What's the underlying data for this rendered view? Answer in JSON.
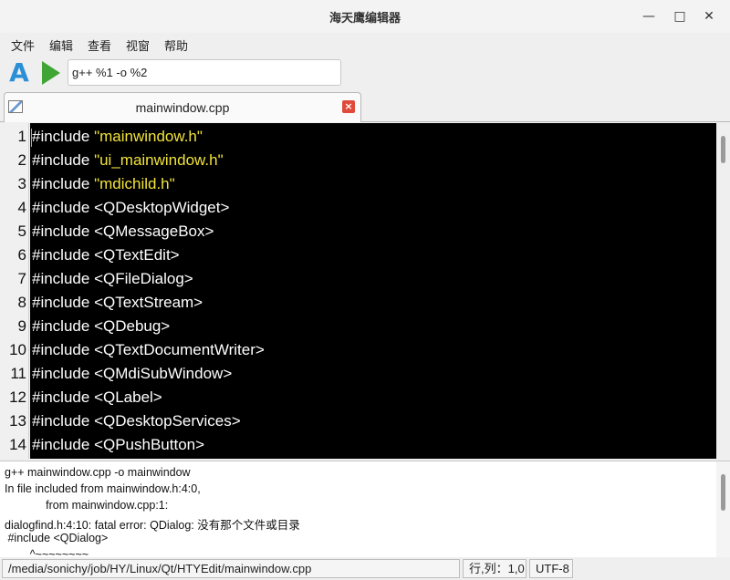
{
  "window": {
    "title": "海天鹰编辑器",
    "minimize": "—",
    "maximize": "□",
    "close": "✕"
  },
  "menu": {
    "items": [
      "文件",
      "编辑",
      "查看",
      "视窗",
      "帮助"
    ]
  },
  "toolbar": {
    "font_icon_glyph": "A",
    "command": "g++ %1 -o %2"
  },
  "tab": {
    "label": "mainwindow.cpp",
    "close_glyph": "×"
  },
  "editor": {
    "line_numbers": [
      "1",
      "2",
      "3",
      "4",
      "5",
      "6",
      "7",
      "8",
      "9",
      "10",
      "11",
      "12",
      "13",
      "14"
    ],
    "lines": [
      {
        "kw": "#include ",
        "str": "\"mainwindow.h\"",
        "rest": ""
      },
      {
        "kw": "#include ",
        "str": "\"ui_mainwindow.h\"",
        "rest": ""
      },
      {
        "kw": "#include ",
        "str": "\"mdichild.h\"",
        "rest": ""
      },
      {
        "kw": "#include ",
        "str": "",
        "rest": "<QDesktopWidget>"
      },
      {
        "kw": "#include ",
        "str": "",
        "rest": "<QMessageBox>"
      },
      {
        "kw": "#include ",
        "str": "",
        "rest": "<QTextEdit>"
      },
      {
        "kw": "#include ",
        "str": "",
        "rest": "<QFileDialog>"
      },
      {
        "kw": "#include ",
        "str": "",
        "rest": "<QTextStream>"
      },
      {
        "kw": "#include ",
        "str": "",
        "rest": "<QDebug>"
      },
      {
        "kw": "#include ",
        "str": "",
        "rest": "<QTextDocumentWriter>"
      },
      {
        "kw": "#include ",
        "str": "",
        "rest": "<QMdiSubWindow>"
      },
      {
        "kw": "#include ",
        "str": "",
        "rest": "<QLabel>"
      },
      {
        "kw": "#include ",
        "str": "",
        "rest": "<QDesktopServices>"
      },
      {
        "kw": "#include ",
        "str": "",
        "rest": "<QPushButton>"
      }
    ],
    "colors": {
      "background": "#000000",
      "string": "#f1e33a",
      "text": "#ffffff"
    }
  },
  "output": {
    "lines": [
      "g++ mainwindow.cpp -o mainwindow",
      "In file included from mainwindow.h:4:0,",
      "             from mainwindow.cpp:1:",
      "dialogfind.h:4:10: fatal error: QDialog: 没有那个文件或目录",
      " #include <QDialog>",
      "        ^~~~~~~~~"
    ]
  },
  "status": {
    "path": "/media/sonichy/job/HY/Linux/Qt/HTYEdit/mainwindow.cpp",
    "position": "行,列：1,0",
    "encoding": "UTF-8"
  }
}
